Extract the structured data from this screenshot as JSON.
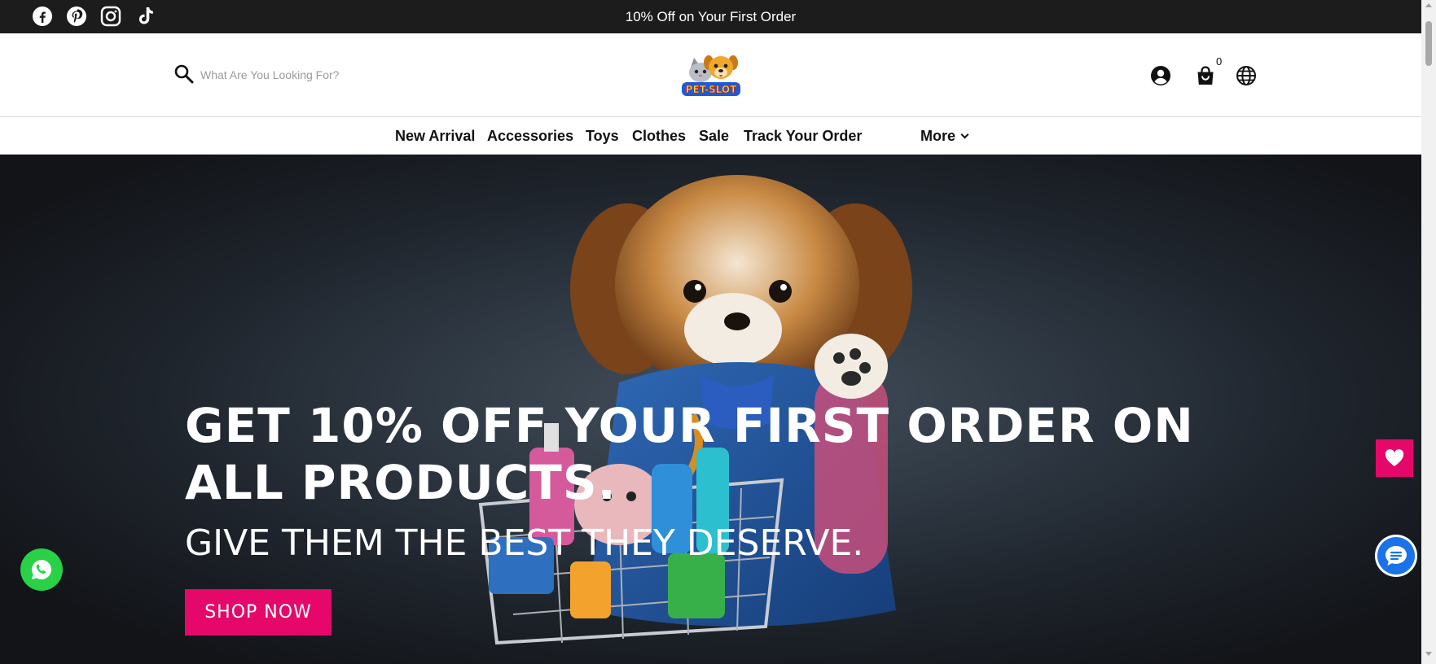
{
  "announcement": {
    "text": "10% Off on Your First Order"
  },
  "social": [
    {
      "name": "facebook-icon"
    },
    {
      "name": "pinterest-icon"
    },
    {
      "name": "instagram-icon"
    },
    {
      "name": "tiktok-icon"
    }
  ],
  "header": {
    "search": {
      "placeholder": "What Are You Looking For?"
    },
    "logo": {
      "text": "PET-SLOT",
      "alt": "Pet Slot"
    },
    "cart_count": "0"
  },
  "nav": {
    "items": [
      "New Arrival",
      "Accessories",
      "Toys",
      "Clothes",
      "Sale",
      "Track Your Order"
    ],
    "more_label": "More"
  },
  "hero": {
    "headline": "GET 10% OFF YOUR FIRST ORDER ON ALL PRODUCTS.",
    "subheadline": "GIVE THEM THE BEST THEY DESERVE.",
    "cta_label": "SHOP NOW"
  },
  "colors": {
    "accent": "#e5086a",
    "topbar": "#1c1c1c",
    "whatsapp": "#28d146",
    "chat": "#1a73e8"
  }
}
